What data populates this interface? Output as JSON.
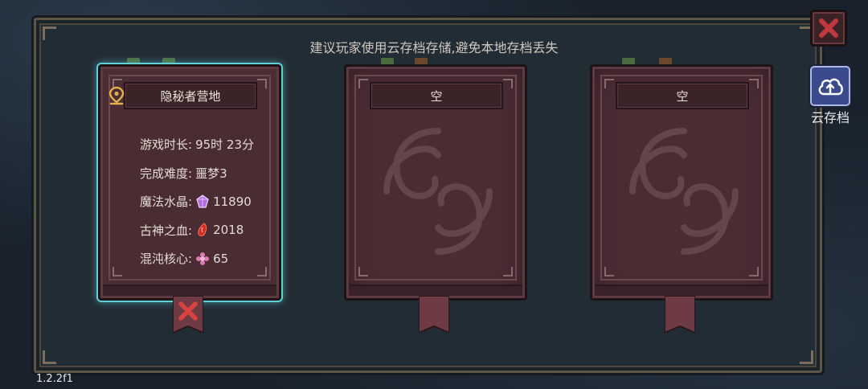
{
  "notice": "建议玩家使用云存档存储,避免本地存档丢失",
  "cloud_save": {
    "label": "云存档",
    "icon": "cloud-upload-icon",
    "color": "#3b4a8c"
  },
  "close": {
    "icon": "close-icon",
    "color": "#c0393f"
  },
  "slots": [
    {
      "title": "隐秘者营地",
      "location_icon": "location-pin-icon",
      "selected": true,
      "stats": [
        {
          "label": "游戏时长:",
          "value": "95时 23分"
        },
        {
          "label": "完成难度:",
          "value": "噩梦3"
        },
        {
          "label": "魔法水晶:",
          "icon": "magic-crystal-icon",
          "value": "11890"
        },
        {
          "label": "古神之血:",
          "icon": "ancient-blood-icon",
          "value": "2018"
        },
        {
          "label": "混沌核心:",
          "icon": "chaos-core-icon",
          "value": "65"
        }
      ],
      "delete_icon": "delete-x-icon"
    },
    {
      "title": "空",
      "selected": false
    },
    {
      "title": "空",
      "selected": false
    }
  ],
  "version": "1.2.2f1"
}
